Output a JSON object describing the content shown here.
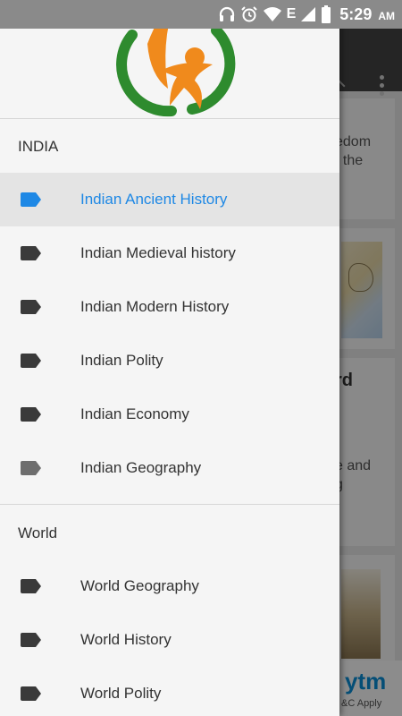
{
  "status_bar": {
    "time": "5:29",
    "ampm": "AM",
    "network": "E"
  },
  "drawer": {
    "sections": [
      {
        "title": "INDIA",
        "items": [
          {
            "label": "Indian Ancient History",
            "active": true,
            "icon": "label-icon",
            "icon_color": "#1e88e5"
          },
          {
            "label": "Indian Medieval history",
            "active": false,
            "icon": "label-icon",
            "icon_color": "#3a3a3a"
          },
          {
            "label": "Indian Modern History",
            "active": false,
            "icon": "label-icon",
            "icon_color": "#3a3a3a"
          },
          {
            "label": "Indian Polity",
            "active": false,
            "icon": "label-icon",
            "icon_color": "#3a3a3a"
          },
          {
            "label": "Indian Economy",
            "active": false,
            "icon": "label-icon",
            "icon_color": "#3a3a3a"
          },
          {
            "label": "Indian Geography",
            "active": false,
            "icon": "label-icon",
            "icon_color": "#6e6e6e"
          }
        ]
      },
      {
        "title": "World",
        "items": [
          {
            "label": "World Geography",
            "active": false,
            "icon": "label-icon",
            "icon_color": "#3a3a3a"
          },
          {
            "label": "World History",
            "active": false,
            "icon": "label-icon",
            "icon_color": "#3a3a3a"
          },
          {
            "label": "World Polity",
            "active": false,
            "icon": "label-icon",
            "icon_color": "#3a3a3a"
          }
        ]
      }
    ]
  },
  "background": {
    "card1_line1": "edom",
    "card1_line2": "f the",
    "card3_title": "rd",
    "card3_line1": "e and",
    "card3_line2": "g",
    "ad_text": "ytm",
    "ad_sub": "&C Apply"
  },
  "colors": {
    "accent": "#1e88e5",
    "logo_orange": "#f08a1c",
    "logo_green": "#2e8b2e"
  }
}
